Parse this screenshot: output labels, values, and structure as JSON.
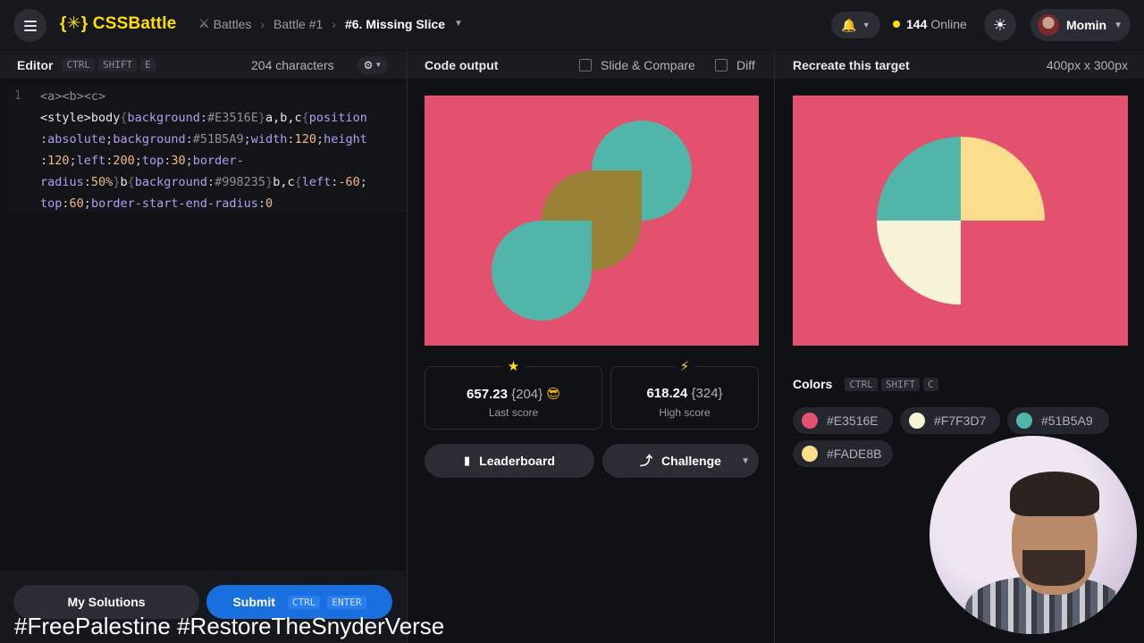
{
  "topbar": {
    "logo": "{✳} CSSBattle",
    "crumbs": [
      "Battles",
      "Battle #1",
      "#6. Missing Slice"
    ],
    "online_count": "144",
    "online_label": "Online",
    "user_name": "Momin"
  },
  "editor": {
    "title": "Editor",
    "shortcut": [
      "CTRL",
      "SHIFT",
      "E"
    ],
    "char_count": "204 characters",
    "line_number": "1",
    "code_lines": [
      "<a><b><c>",
      "<style>body{background:#E3516E}a,b,c{position",
      ":absolute;background:#51B5A9;width:120;height",
      ":120;left:200;top:30;border-",
      "radius:50%}b{background:#998235}b,c{left:-60;",
      "top:60;border-start-end-radius:0"
    ],
    "code_html": [
      "<span class='t-dim'>&lt;a&gt;&lt;b&gt;&lt;c&gt;</span>",
      "<span class='t-tag'>&lt;style&gt;body</span><span class='t-br'>{</span><span class='t-prop'>background</span>:<span class='t-dim'>#E3516E</span><span class='t-br'>}</span><span class='t-tag'>a,b,c</span><span class='t-br'>{</span><span class='t-prop'>position</span>",
      ":<span class='t-prop'>absolute</span>;<span class='t-prop'>background</span>:<span class='t-dim'>#51B5A9</span>;<span class='t-prop'>width</span>:<span class='t-val'>120</span>;<span class='t-prop'>height</span>",
      ":<span class='t-val'>120</span>;<span class='t-prop'>left</span>:<span class='t-val'>200</span>;<span class='t-prop'>top</span>:<span class='t-val'>30</span>;<span class='t-prop'>border-</span>",
      "<span class='t-prop'>radius</span>:<span class='t-val'>50%</span><span class='t-br'>}</span><span class='t-tag'>b</span><span class='t-br'>{</span><span class='t-prop'>background</span>:<span class='t-dim'>#998235</span><span class='t-br'>}</span><span class='t-tag'>b,c</span><span class='t-br'>{</span><span class='t-prop'>left</span>:<span class='t-val'>-60</span>;",
      "<span class='t-prop'>top</span>:<span class='t-val'>60</span>;<span class='t-prop'>border-start-end-radius</span>:<span class='t-val'>0</span>"
    ]
  },
  "output": {
    "title": "Code output",
    "slide_compare": "Slide & Compare",
    "diff": "Diff"
  },
  "target": {
    "title": "Recreate this target",
    "size": "400px x 300px"
  },
  "scores": {
    "last_score": "657.23",
    "last_chars": "{204}",
    "last_label": "Last score",
    "high_score": "618.24",
    "high_chars": "{324}",
    "high_label": "High score"
  },
  "actions": {
    "leaderboard": "Leaderboard",
    "challenge": "Challenge",
    "my_solutions": "My Solutions",
    "submit": "Submit",
    "submit_shortcut": [
      "CTRL",
      "ENTER"
    ]
  },
  "colors": {
    "title": "Colors",
    "shortcut": [
      "CTRL",
      "SHIFT",
      "C"
    ],
    "swatches": [
      "#E3516E",
      "#F7F3D7",
      "#51B5A9",
      "#FADE8B"
    ]
  },
  "overlay": {
    "hashtags": "#FreePalestine  #RestoreTheSnyderVerse"
  }
}
